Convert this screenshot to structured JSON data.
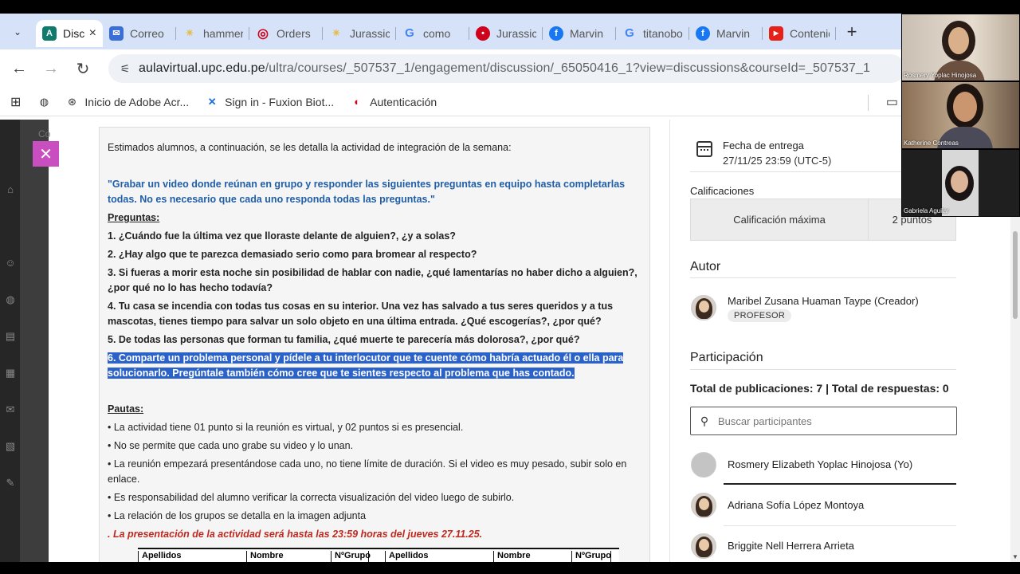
{
  "browser": {
    "tabs": [
      {
        "title": "Discusión",
        "color": "#0f7b6c",
        "glyph": "A",
        "active": true
      },
      {
        "title": "Correo",
        "color": "#3a6fd8",
        "glyph": "✉"
      },
      {
        "title": "hammer",
        "color": "#e6b93a",
        "glyph": "✳"
      },
      {
        "title": "Orders",
        "color": "#d0021b",
        "glyph": "◎"
      },
      {
        "title": "Jurassic",
        "color": "#e6b93a",
        "glyph": "✳"
      },
      {
        "title": "como",
        "color": "#4285f4",
        "glyph": "G"
      },
      {
        "title": "Jurassic",
        "color": "#d0021b",
        "glyph": "◉"
      },
      {
        "title": "Marvin",
        "color": "#1877f2",
        "glyph": "f"
      },
      {
        "title": "titanoboa",
        "color": "#4285f4",
        "glyph": "G"
      },
      {
        "title": "Marvin",
        "color": "#1877f2",
        "glyph": "f"
      },
      {
        "title": "Contenido",
        "color": "#e62117",
        "glyph": "▶"
      }
    ],
    "url_host": "aulavirtual.upc.edu.pe",
    "url_path": "/ultra/courses/_507537_1/engagement/discussion/_65050416_1?view=discussions&courseId=_507537_1",
    "bookmarks": [
      {
        "label": "",
        "icon": "globe-icon",
        "glyph": "🌐"
      },
      {
        "label": "Inicio de Adobe Acr...",
        "icon": "adobe-icon",
        "glyph": "⊙"
      },
      {
        "label": "Sign in - Fuxion Biot...",
        "icon": "fuxion-icon",
        "glyph": "✕"
      },
      {
        "label": "Autenticación",
        "icon": "upc-icon",
        "glyph": "◐"
      }
    ]
  },
  "background": {
    "label": "Co"
  },
  "content": {
    "intro": "Estimados alumnos, a continuación, se les detalla la actividad de integración de la semana:",
    "task": "\"Grabar un video donde reúnan en grupo y responder las siguientes preguntas en equipo hasta completarlas todas. No es necesario que cada uno responda todas las preguntas.\"",
    "questions_title": "Preguntas:",
    "questions": [
      "1. ¿Cuándo fue la última vez que lloraste delante de alguien?, ¿y a solas?",
      "2. ¿Hay algo que te parezca demasiado serio como para bromear al respecto?",
      "3. Si fueras a morir esta noche sin posibilidad de hablar con nadie, ¿qué lamentarías no haber dicho a alguien?, ¿por qué no lo has hecho todavía?",
      "4. Tu casa se incendia con todas tus cosas en su interior. Una vez has salvado a tus seres queridos y a tus mascotas, tienes tiempo para salvar un solo objeto en una última entrada. ¿Qué escogerías?, ¿por qué?",
      "5. De todas las personas que forman tu familia, ¿qué muerte te parecería más dolorosa?, ¿por qué?"
    ],
    "q6_line1": "6. Comparte un problema personal y pídele a tu interlocutor que te cuente cómo habría actuado él o ella para",
    "q6_line2": "solucionarlo. Pregúntale también cómo cree que te sientes respecto al problema que has contado.",
    "guidelines_title": "Pautas:",
    "guidelines": [
      "• La actividad tiene 01 punto si la reunión es virtual, y 02 puntos si es presencial.",
      "• No se permite que cada uno grabe su video y lo unan.",
      "• La reunión empezará presentándose cada uno, no tiene límite de duración. Si el video es muy pesado, subir solo en enlace.",
      "• Es responsabilidad del alumno verificar la correcta visualización del video luego de subirlo.",
      "• La relación de los grupos se detalla en la imagen adjunta"
    ],
    "deadline": ". La presentación de la actividad será hasta las 23:59 horas del jueves 27.11.25.",
    "table_headers": [
      "Apellidos",
      "Nombre",
      "NºGrupo",
      "Apellidos",
      "Nombre",
      "NºGrupo"
    ]
  },
  "sidebar": {
    "due_label": "Fecha de entrega",
    "due_date": "27/11/25 23:59 (UTC-5)",
    "grades_label": "Calificaciones",
    "max_grade_label": "Calificación máxima",
    "max_grade_value": "2 puntos",
    "author_title": "Autor",
    "author_name": "Maribel Zusana Huaman Taype (Creador)",
    "author_role": "PROFESOR",
    "participation_title": "Participación",
    "totals": "Total de publicaciones: 7 | Total de respuestas: 0",
    "search_placeholder": "Buscar participantes",
    "participants": [
      "Rosmery Elizabeth Yoplac Hinojosa (Yo)",
      "Adriana Sofía López Montoya",
      "Briggite Nell Herrera Arrieta"
    ]
  },
  "video_call": [
    "Rosmery Yoplac Hinojosa",
    "Katherine Contreas",
    "Gabriela Aguilar"
  ]
}
